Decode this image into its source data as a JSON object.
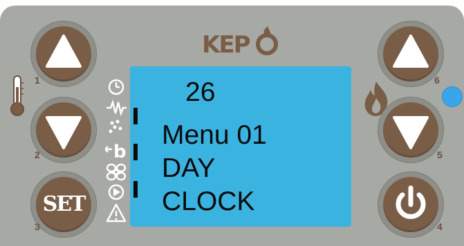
{
  "brand": {
    "logo_text": "KEPO"
  },
  "buttons": {
    "up_left": {
      "number": "1"
    },
    "down_left": {
      "number": "2"
    },
    "set": {
      "label": "SET",
      "number": "3"
    },
    "up_right": {
      "number": "6"
    },
    "down_right": {
      "number": "5"
    },
    "power": {
      "number": "4"
    }
  },
  "lcd": {
    "line1": "26",
    "line2": "Menu 01",
    "line3": "DAY",
    "line4": "CLOCK"
  },
  "icons": {
    "thermometer": "thermometer-icon",
    "clock": "clock-icon",
    "heater": "heater-icon",
    "pellets": "pellets-icon",
    "pump": "pump-icon",
    "fan": "fan-icon",
    "play": "play-icon",
    "warning": "warning-icon",
    "flame": "flame-icon"
  },
  "colors": {
    "panel": "#a7a9a4",
    "button": "#7a5d47",
    "lcd": "#3bb3e0",
    "led": "#3aa6ea"
  }
}
